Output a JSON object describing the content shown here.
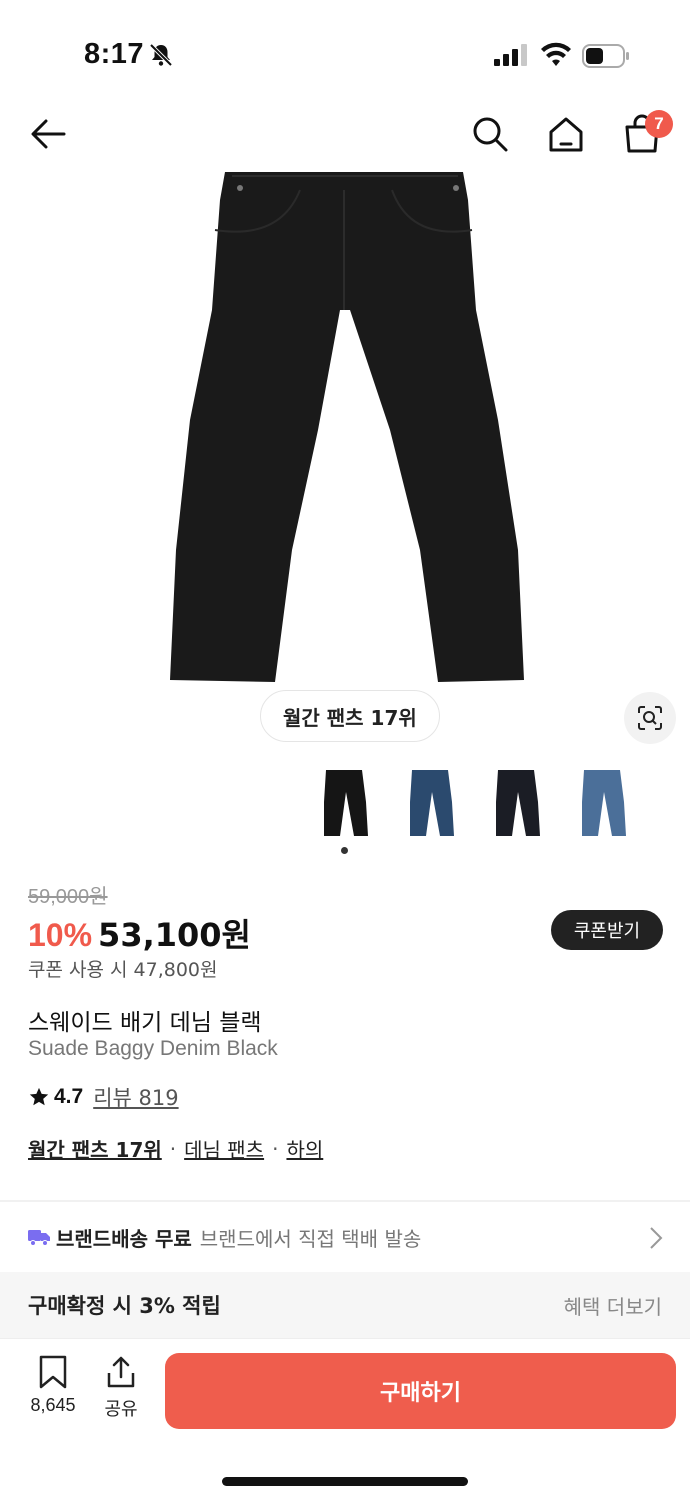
{
  "status": {
    "time": "8:17"
  },
  "nav": {
    "cart_count": "7"
  },
  "hero": {
    "rank_label": "월간 팬츠 17위"
  },
  "colors": {
    "accent": "#f05a4c",
    "buy_button": "#ef5d4d",
    "dark_pill": "#222222"
  },
  "thumbnails": [
    {
      "color": "black"
    },
    {
      "color": "dark-blue"
    },
    {
      "color": "navy-black"
    },
    {
      "color": "mid-blue"
    }
  ],
  "product": {
    "original_price": "59,000원",
    "discount": "10%",
    "price": "53,100원",
    "coupon_button": "쿠폰받기",
    "coupon_price": "쿠폰 사용 시 47,800원",
    "name_ko": "스웨이드 배기 데님 블랙",
    "name_en": "Suade Baggy Denim Black",
    "rating": "4.7",
    "review_label": "리뷰 819",
    "categories": [
      "월간 팬츠 17위",
      "데님 팬츠",
      "하의"
    ]
  },
  "shipping": {
    "title": "브랜드배송 무료",
    "sub": "브랜드에서 직접 택배 발송"
  },
  "benefit": {
    "title": "구매확정 시 3% 적립",
    "more": "혜택 더보기"
  },
  "bottom": {
    "bookmark_count": "8,645",
    "share_label": "공유",
    "buy_label": "구매하기"
  }
}
